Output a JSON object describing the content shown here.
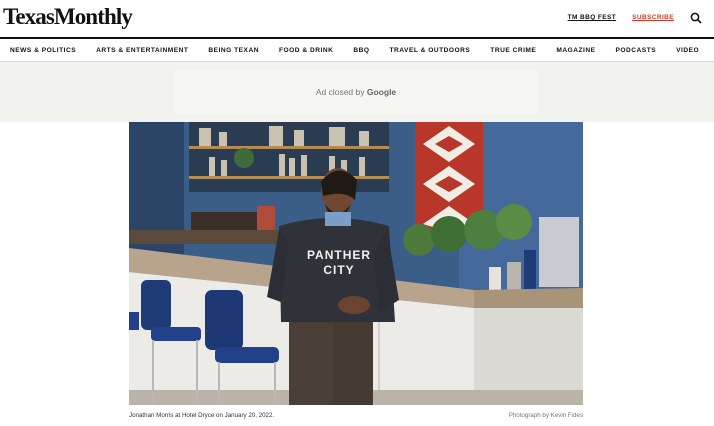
{
  "header": {
    "logo": "TexasMonthly",
    "links": [
      "TM BBQ FEST",
      "SUBSCRIBE"
    ],
    "search_icon": "search-icon"
  },
  "nav": {
    "items": [
      "NEWS & POLITICS",
      "ARTS & ENTERTAINMENT",
      "BEING TEXAN",
      "FOOD & DRINK",
      "BBQ",
      "TRAVEL & OUTDOORS",
      "TRUE CRIME",
      "MAGAZINE",
      "PODCASTS",
      "VIDEO"
    ]
  },
  "ad": {
    "text_prefix": "Ad closed by",
    "brand": "Google"
  },
  "photo": {
    "sweater_text_line1": "PANTHER",
    "sweater_text_line2": "CITY"
  },
  "caption": {
    "text": "Jonathan Morris at Hotel Dryce on January 20, 2022.",
    "credit": "Photograph by Kevin Fides"
  },
  "colors": {
    "subscribe": "#d63a2a",
    "wall_blue": "#3a5f8a",
    "chair_blue": "#1f3b78"
  }
}
